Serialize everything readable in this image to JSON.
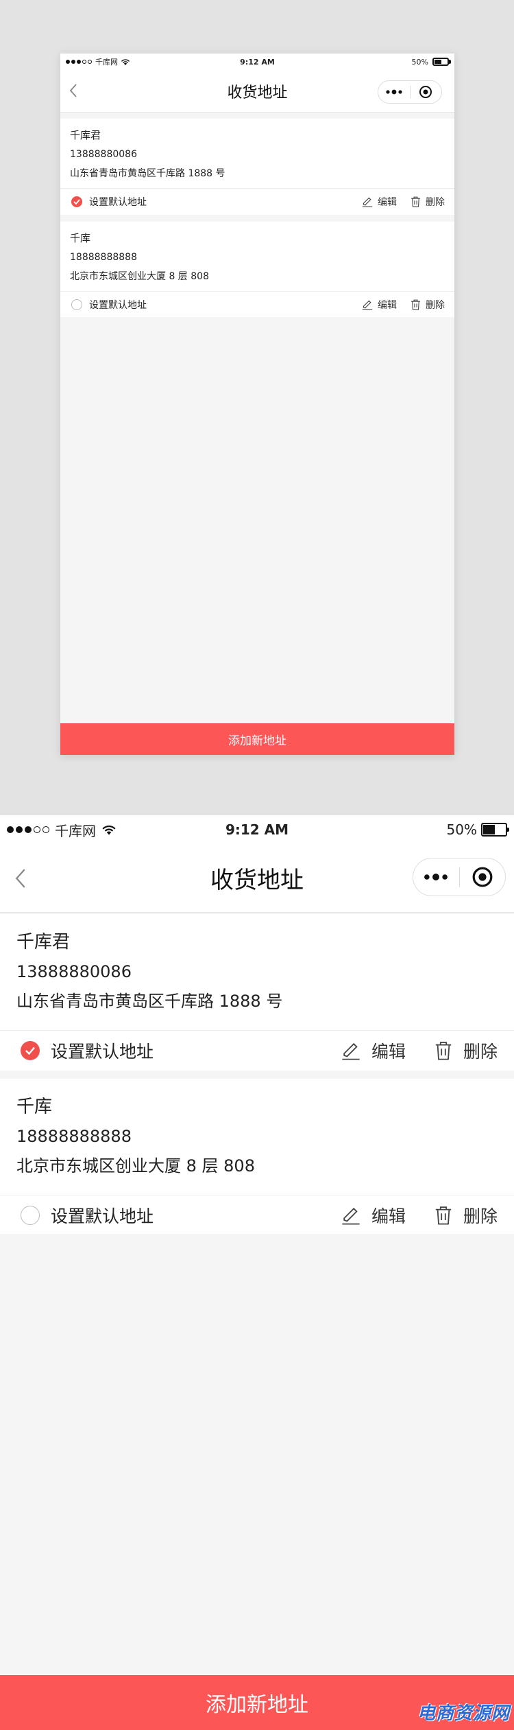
{
  "status": {
    "carrier": "千库网",
    "time": "9:12 AM",
    "battery": "50%",
    "battery_level": 0.5
  },
  "navbar": {
    "title": "收货地址"
  },
  "addresses": [
    {
      "name": "千库君",
      "phone": "13888880086",
      "address": "山东省青岛市黄岛区千库路 1888 号",
      "is_default": true
    },
    {
      "name": "千库",
      "phone": "18888888888",
      "address": "北京市东城区创业大厦 8 层 808",
      "is_default": false
    }
  ],
  "actions": {
    "set_default": "设置默认地址",
    "edit": "编辑",
    "delete": "删除"
  },
  "add_button": "添加新地址",
  "watermark": "电商资源网",
  "colors": {
    "accent": "#fc5756",
    "check": "#f0504b",
    "background": "#f5f5f5"
  }
}
